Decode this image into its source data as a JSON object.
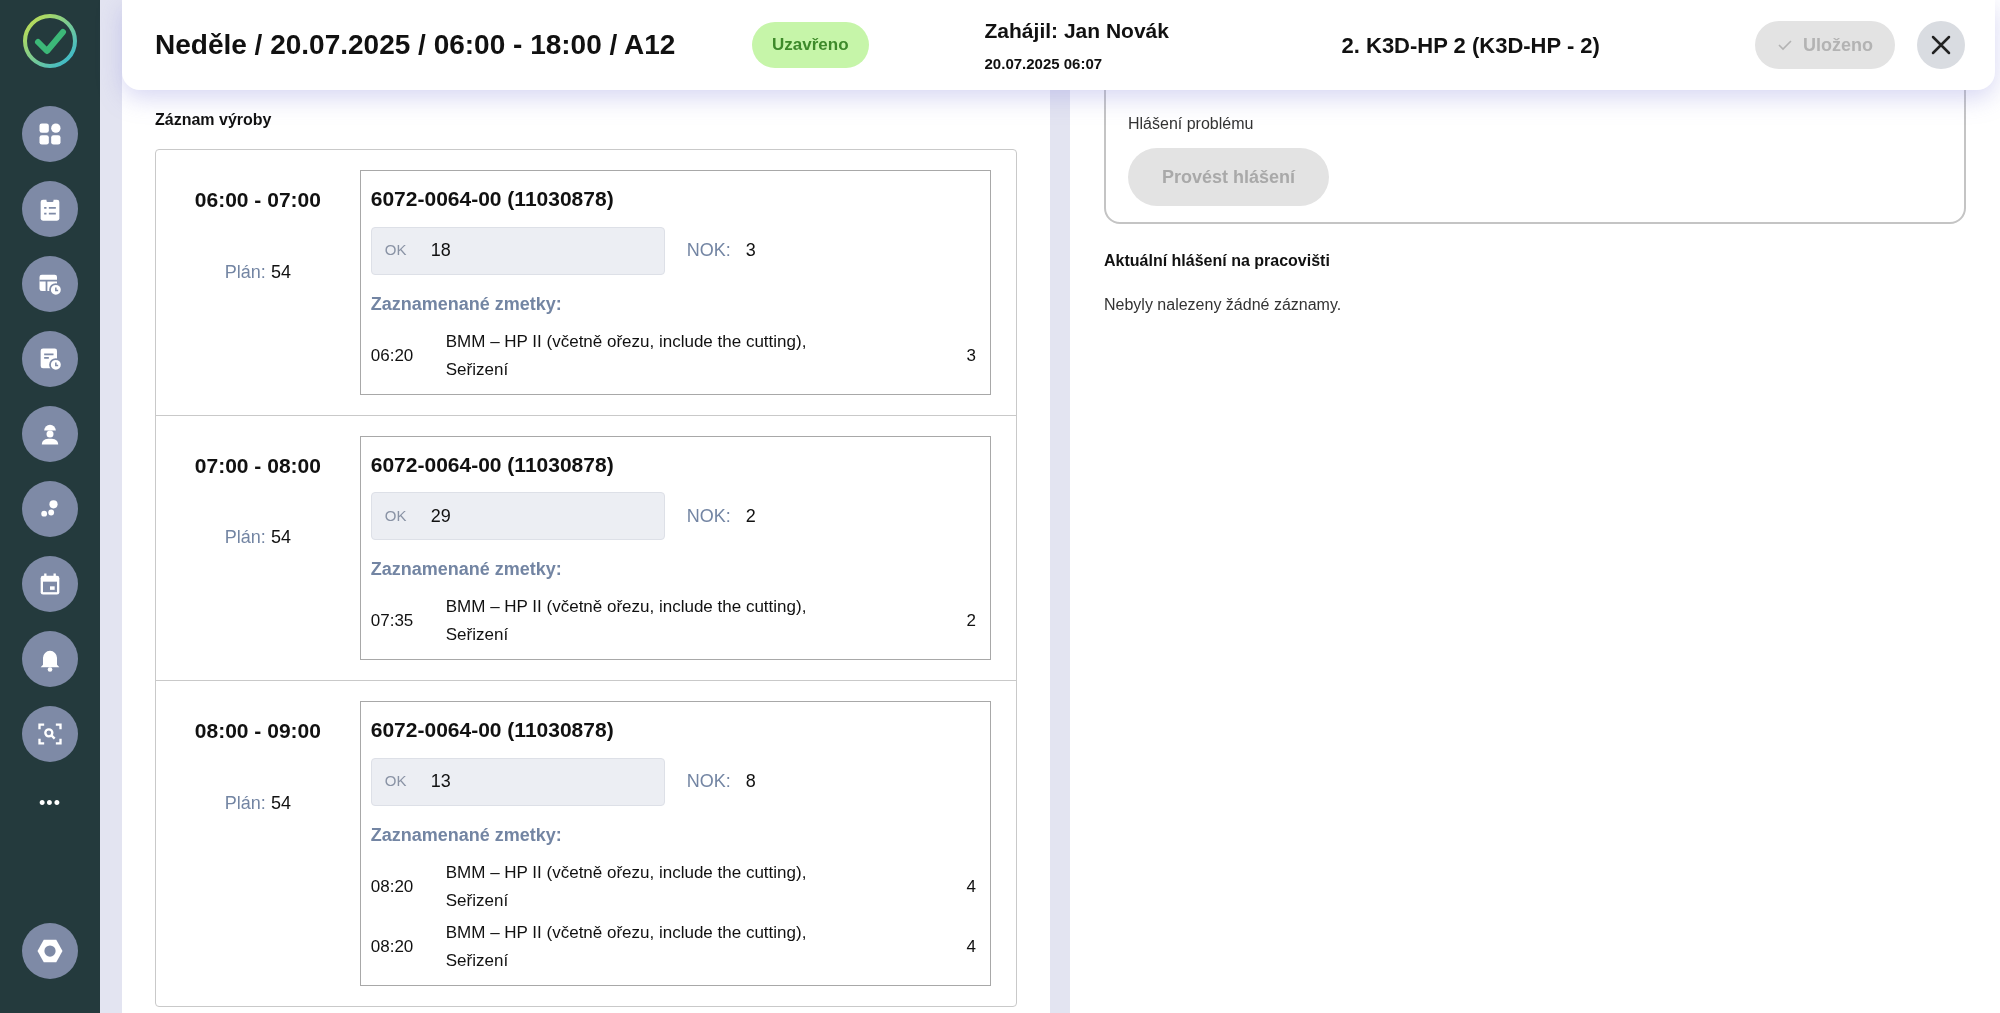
{
  "sidebar": {
    "items": [
      {
        "kind": "dashboard"
      },
      {
        "kind": "clipboard"
      },
      {
        "kind": "table-clock"
      },
      {
        "kind": "calendar-clock"
      },
      {
        "kind": "worker"
      },
      {
        "kind": "bubbles"
      },
      {
        "kind": "calendar"
      },
      {
        "kind": "bell"
      },
      {
        "kind": "scan"
      }
    ],
    "more": "•••"
  },
  "header": {
    "title": "Neděle / 20.07.2025 / 06:00 - 18:00 / A12",
    "status_badge": "Uzavřeno",
    "started_by": "Zahájil: Jan Novák",
    "started_at": "20.07.2025 06:07",
    "workplace": "2. K3D-HP 2 (K3D-HP - 2)",
    "save_button": {
      "label": "Uloženo",
      "disabled": true
    }
  },
  "production_log": {
    "title": "Záznam výroby",
    "hours": [
      {
        "time": "06:00 - 07:00",
        "plan_label": "Plán:",
        "plan_value": "54",
        "product": "6072-0064-00 (11030878)",
        "ok_label": "OK",
        "ok_value": "18",
        "nok_label": "NOK:",
        "nok_value": "3",
        "scrap_title": "Zaznamenané zmetky:",
        "scraps": [
          {
            "time": "06:20",
            "reason": "BMM – HP II (včetně ořezu, include the cutting), Seřizení",
            "count": "3"
          }
        ]
      },
      {
        "time": "07:00 - 08:00",
        "plan_label": "Plán:",
        "plan_value": "54",
        "product": "6072-0064-00 (11030878)",
        "ok_label": "OK",
        "ok_value": "29",
        "nok_label": "NOK:",
        "nok_value": "2",
        "scrap_title": "Zaznamenané zmetky:",
        "scraps": [
          {
            "time": "07:35",
            "reason": "BMM – HP II (včetně ořezu, include the cutting), Seřizení",
            "count": "2"
          }
        ]
      },
      {
        "time": "08:00 - 09:00",
        "plan_label": "Plán:",
        "plan_value": "54",
        "product": "6072-0064-00 (11030878)",
        "ok_label": "OK",
        "ok_value": "13",
        "nok_label": "NOK:",
        "nok_value": "8",
        "scrap_title": "Zaznamenané zmetky:",
        "scraps": [
          {
            "time": "08:20",
            "reason": "BMM – HP II (včetně ořezu, include the cutting), Seřizení",
            "count": "4"
          },
          {
            "time": "08:20",
            "reason": "BMM – HP II (včetně ořezu, include the cutting), Seřizení",
            "count": "4"
          }
        ]
      }
    ]
  },
  "problem_card": {
    "subtitle": "Hlášení problému",
    "button": {
      "label": "Provést hlášení",
      "disabled": true
    }
  },
  "current_reports": {
    "title": "Aktuální hlášení na pracovišti",
    "empty_text": "Nebyly nalezeny žádné záznamy."
  }
}
